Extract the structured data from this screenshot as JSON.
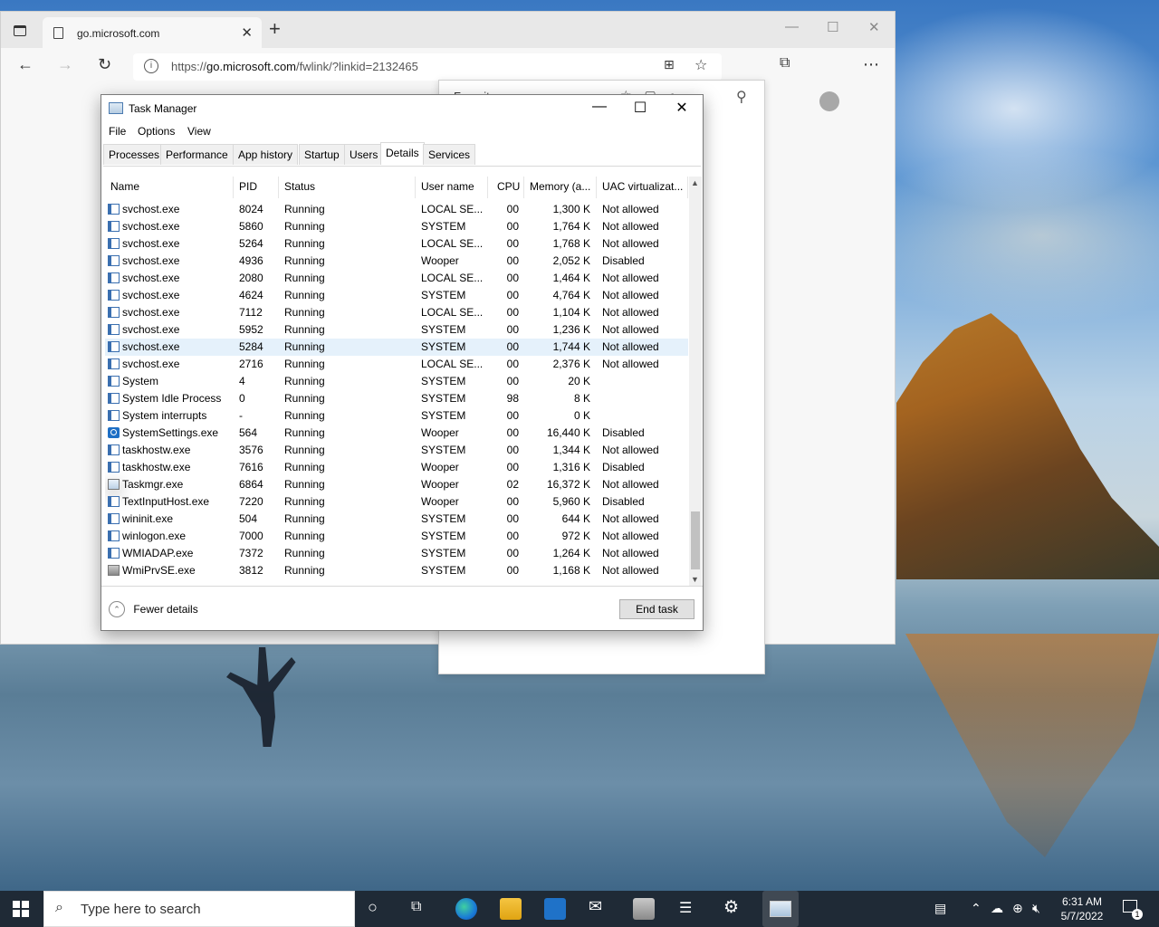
{
  "browser": {
    "tab_title": "go.microsoft.com",
    "url_prefix": "https://",
    "url_host": "go.microsoft.com",
    "url_path": "/fwlink/?linkid=2132465",
    "flyout_title": "Favorites"
  },
  "task_manager": {
    "title": "Task Manager",
    "menu": [
      "File",
      "Options",
      "View"
    ],
    "tabs": [
      "Processes",
      "Performance",
      "App history",
      "Startup",
      "Users",
      "Details",
      "Services"
    ],
    "active_tab": "Details",
    "columns": [
      "Name",
      "PID",
      "Status",
      "User name",
      "CPU",
      "Memory (a...",
      "UAC virtualizat..."
    ],
    "rows": [
      {
        "name": "svchost.exe",
        "pid": "8024",
        "status": "Running",
        "user": "LOCAL SE...",
        "cpu": "00",
        "mem": "1,300 K",
        "uac": "Not allowed",
        "icon": "std"
      },
      {
        "name": "svchost.exe",
        "pid": "5860",
        "status": "Running",
        "user": "SYSTEM",
        "cpu": "00",
        "mem": "1,764 K",
        "uac": "Not allowed",
        "icon": "std"
      },
      {
        "name": "svchost.exe",
        "pid": "5264",
        "status": "Running",
        "user": "LOCAL SE...",
        "cpu": "00",
        "mem": "1,768 K",
        "uac": "Not allowed",
        "icon": "std"
      },
      {
        "name": "svchost.exe",
        "pid": "4936",
        "status": "Running",
        "user": "Wooper",
        "cpu": "00",
        "mem": "2,052 K",
        "uac": "Disabled",
        "icon": "std"
      },
      {
        "name": "svchost.exe",
        "pid": "2080",
        "status": "Running",
        "user": "LOCAL SE...",
        "cpu": "00",
        "mem": "1,464 K",
        "uac": "Not allowed",
        "icon": "std"
      },
      {
        "name": "svchost.exe",
        "pid": "4624",
        "status": "Running",
        "user": "SYSTEM",
        "cpu": "00",
        "mem": "4,764 K",
        "uac": "Not allowed",
        "icon": "std"
      },
      {
        "name": "svchost.exe",
        "pid": "7112",
        "status": "Running",
        "user": "LOCAL SE...",
        "cpu": "00",
        "mem": "1,104 K",
        "uac": "Not allowed",
        "icon": "std"
      },
      {
        "name": "svchost.exe",
        "pid": "5952",
        "status": "Running",
        "user": "SYSTEM",
        "cpu": "00",
        "mem": "1,236 K",
        "uac": "Not allowed",
        "icon": "std"
      },
      {
        "name": "svchost.exe",
        "pid": "5284",
        "status": "Running",
        "user": "SYSTEM",
        "cpu": "00",
        "mem": "1,744 K",
        "uac": "Not allowed",
        "icon": "std",
        "selected": true
      },
      {
        "name": "svchost.exe",
        "pid": "2716",
        "status": "Running",
        "user": "LOCAL SE...",
        "cpu": "00",
        "mem": "2,376 K",
        "uac": "Not allowed",
        "icon": "std"
      },
      {
        "name": "System",
        "pid": "4",
        "status": "Running",
        "user": "SYSTEM",
        "cpu": "00",
        "mem": "20 K",
        "uac": "",
        "icon": "std"
      },
      {
        "name": "System Idle Process",
        "pid": "0",
        "status": "Running",
        "user": "SYSTEM",
        "cpu": "98",
        "mem": "8 K",
        "uac": "",
        "icon": "std"
      },
      {
        "name": "System interrupts",
        "pid": "-",
        "status": "Running",
        "user": "SYSTEM",
        "cpu": "00",
        "mem": "0 K",
        "uac": "",
        "icon": "std"
      },
      {
        "name": "SystemSettings.exe",
        "pid": "564",
        "status": "Running",
        "user": "Wooper",
        "cpu": "00",
        "mem": "16,440 K",
        "uac": "Disabled",
        "icon": "gear"
      },
      {
        "name": "taskhostw.exe",
        "pid": "3576",
        "status": "Running",
        "user": "SYSTEM",
        "cpu": "00",
        "mem": "1,344 K",
        "uac": "Not allowed",
        "icon": "std"
      },
      {
        "name": "taskhostw.exe",
        "pid": "7616",
        "status": "Running",
        "user": "Wooper",
        "cpu": "00",
        "mem": "1,316 K",
        "uac": "Disabled",
        "icon": "std"
      },
      {
        "name": "Taskmgr.exe",
        "pid": "6864",
        "status": "Running",
        "user": "Wooper",
        "cpu": "02",
        "mem": "16,372 K",
        "uac": "Not allowed",
        "icon": "tm"
      },
      {
        "name": "TextInputHost.exe",
        "pid": "7220",
        "status": "Running",
        "user": "Wooper",
        "cpu": "00",
        "mem": "5,960 K",
        "uac": "Disabled",
        "icon": "std"
      },
      {
        "name": "wininit.exe",
        "pid": "504",
        "status": "Running",
        "user": "SYSTEM",
        "cpu": "00",
        "mem": "644 K",
        "uac": "Not allowed",
        "icon": "std"
      },
      {
        "name": "winlogon.exe",
        "pid": "7000",
        "status": "Running",
        "user": "SYSTEM",
        "cpu": "00",
        "mem": "972 K",
        "uac": "Not allowed",
        "icon": "std"
      },
      {
        "name": "WMIADAP.exe",
        "pid": "7372",
        "status": "Running",
        "user": "SYSTEM",
        "cpu": "00",
        "mem": "1,264 K",
        "uac": "Not allowed",
        "icon": "std"
      },
      {
        "name": "WmiPrvSE.exe",
        "pid": "3812",
        "status": "Running",
        "user": "SYSTEM",
        "cpu": "00",
        "mem": "1,168 K",
        "uac": "Not allowed",
        "icon": "wmi"
      }
    ],
    "fewer_details_label": "Fewer details",
    "end_task_label": "End task"
  },
  "taskbar": {
    "search_placeholder": "Type here to search",
    "time": "6:31 AM",
    "date": "5/7/2022",
    "notification_count": "1"
  }
}
